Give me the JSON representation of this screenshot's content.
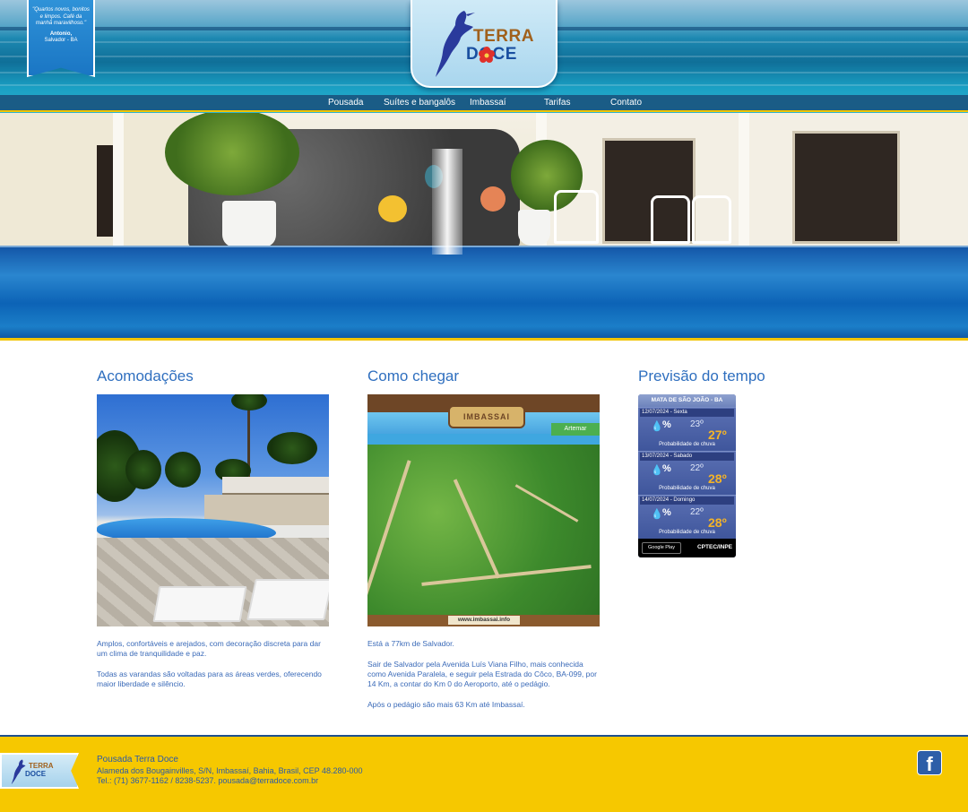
{
  "testimonial": {
    "quote": "\"Quartos novos, bonitos e limpos. Café da manhã maravilhoso.\"",
    "author": "Antonio,",
    "city": "Salvador - BA"
  },
  "logo": {
    "line1": "TERRA",
    "line2": "DOCE"
  },
  "nav": [
    {
      "label": "Pousada"
    },
    {
      "label": "Suítes e bangalôs"
    },
    {
      "label": "Imbassaí"
    },
    {
      "label": "Tarifas"
    },
    {
      "label": "Contato"
    }
  ],
  "sections": {
    "acomodacoes": {
      "title": "Acomodações",
      "paragraphs": [
        "Amplos, confortáveis e arejados, com decoração discreta para dar um clima de tranquilidade e paz.",
        "Todas as varandas são voltadas para as áreas verdes, oferecendo maior liberdade e silêncio."
      ]
    },
    "como_chegar": {
      "title": "Como chegar",
      "map_banner": "IMBASSAI",
      "map_tag": "Artemar",
      "map_url": "www.imbassai.info",
      "paragraphs": [
        "Está a 77km de Salvador.",
        "Sair de Salvador pela Avenida Luís Viana Filho, mais conhecida como Avenida Paralela, e seguir pela Estrada do Côco, BA-099, por 14 Km, a contar do Km 0 do Aeroporto, até o pedágio.",
        "Após o pedágio são mais 63 Km até Imbassaí."
      ]
    },
    "previsao": {
      "title": "Previsão do tempo",
      "widget": {
        "location": "MATA DE SÃO JOÃO - BA",
        "days": [
          {
            "date": "12/07/2024 - Sexta",
            "rain": "%",
            "min": "23º",
            "max": "27º",
            "label": "Probabilidade de chuva"
          },
          {
            "date": "13/07/2024 - Sabado",
            "rain": "%",
            "min": "22º",
            "max": "28º",
            "label": "Probabilidade de chuva"
          },
          {
            "date": "14/07/2024 - Domingo",
            "rain": "%",
            "min": "22º",
            "max": "28º",
            "label": "Probabilidade de chuva"
          }
        ],
        "store": "Google Play",
        "source": "CPTEC/INPE"
      }
    }
  },
  "footer": {
    "name": "Pousada Terra Doce",
    "address": "Alameda dos Bougainvilles, S/N, Imbassaí, Bahia, Brasil, CEP 48.280-000",
    "contact": "Tel.: (71) 3677-1162 / 8238-5237. pousada@terradoce.com.br",
    "logo_line1": "TERRA",
    "logo_line2": "DOCE",
    "social": "f"
  },
  "colors": {
    "accent": "#2f6fbf",
    "footer_bg": "#f6c800",
    "nav_bg": "#1a5c86",
    "highlight": "#f2c400"
  }
}
